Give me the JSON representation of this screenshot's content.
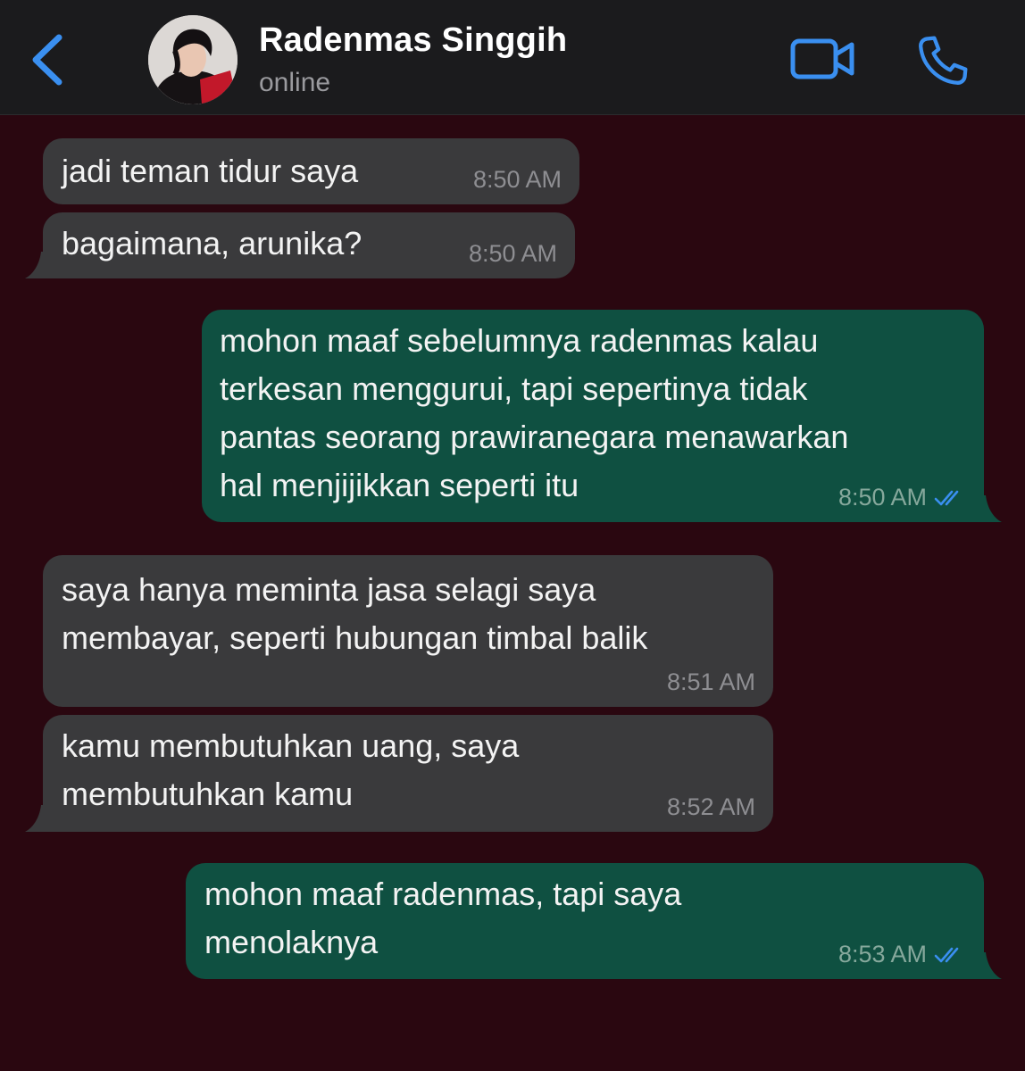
{
  "header": {
    "back_icon": "chevron-left-icon",
    "contact_name": "Radenmas Singgih",
    "status": "online",
    "video_icon": "video-camera-icon",
    "call_icon": "phone-icon",
    "accent_color": "#3a8ff0"
  },
  "chat": {
    "background_color": "#2a0710",
    "messages": [
      {
        "direction": "incoming",
        "text": "jadi teman tidur saya",
        "time": "8:50 AM"
      },
      {
        "direction": "incoming",
        "text": "bagaimana, arunika?",
        "time": "8:50 AM"
      },
      {
        "direction": "outgoing",
        "text": "mohon maaf sebelumnya radenmas kalau\nterkesan menggurui, tapi sepertinya tidak\npantas seorang prawiranegara menawarkan\nhal menjijikkan seperti itu",
        "time": "8:50 AM",
        "status": "read"
      },
      {
        "direction": "incoming",
        "text": "saya hanya meminta jasa selagi saya\nmembayar, seperti hubungan timbal balik",
        "time": "8:51 AM"
      },
      {
        "direction": "incoming",
        "text": "kamu membutuhkan uang, saya\nmembutuhkan kamu",
        "time": "8:52 AM"
      },
      {
        "direction": "outgoing",
        "text": "mohon maaf radenmas, tapi saya\nmenolaknya",
        "time": "8:53 AM",
        "status": "read"
      }
    ]
  }
}
